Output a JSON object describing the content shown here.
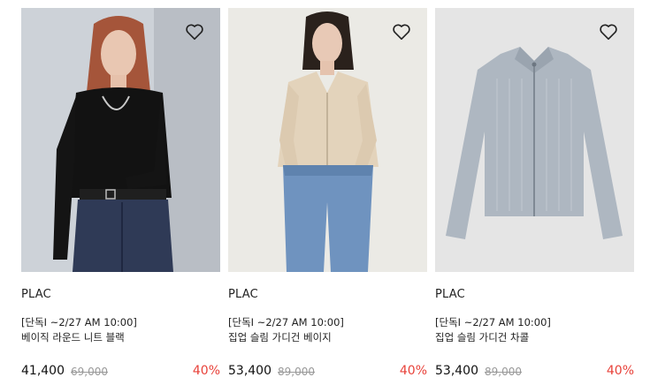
{
  "products": [
    {
      "brand": "PLAC",
      "tag": "[단독I ~2/27 AM 10:00]",
      "name": "베이직 라운드 니트 블랙",
      "price": "41,400",
      "original_price": "69,000",
      "discount": "40%",
      "wishlist_icon": "heart-outline-icon",
      "image_bg": "#cfd3d8"
    },
    {
      "brand": "PLAC",
      "tag": "[단독I ~2/27 AM 10:00]",
      "name": "집업 슬림 가디건 베이지",
      "price": "53,400",
      "original_price": "89,000",
      "discount": "40%",
      "wishlist_icon": "heart-outline-icon",
      "image_bg": "#e9e8e3"
    },
    {
      "brand": "PLAC",
      "tag": "[단독I ~2/27 AM 10:00]",
      "name": "집업 슬림 가디건 차콜",
      "price": "53,400",
      "original_price": "89,000",
      "discount": "40%",
      "wishlist_icon": "heart-outline-icon",
      "image_bg": "#e4e4e4"
    }
  ],
  "colors": {
    "discount": "#e8423a",
    "strike": "#999999"
  }
}
